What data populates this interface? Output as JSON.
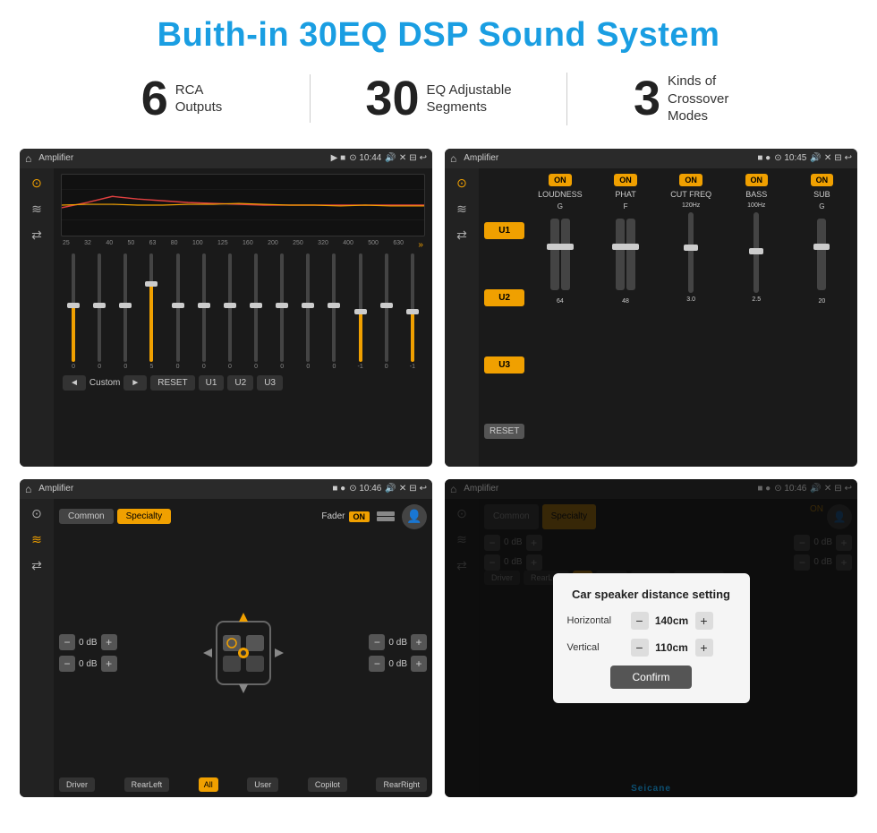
{
  "page": {
    "title": "Buith-in 30EQ DSP Sound System",
    "stats": [
      {
        "number": "6",
        "label": "RCA\nOutputs"
      },
      {
        "number": "30",
        "label": "EQ Adjustable\nSegments"
      },
      {
        "number": "3",
        "label": "Kinds of\nCrossover Modes"
      }
    ],
    "screens": [
      {
        "id": "eq-screen",
        "statusBar": {
          "title": "Amplifier",
          "time": "10:44"
        },
        "type": "eq"
      },
      {
        "id": "amp-screen",
        "statusBar": {
          "title": "Amplifier",
          "time": "10:45"
        },
        "type": "amp"
      },
      {
        "id": "fader-screen",
        "statusBar": {
          "title": "Amplifier",
          "time": "10:46"
        },
        "type": "fader"
      },
      {
        "id": "dialog-screen",
        "statusBar": {
          "title": "Amplifier",
          "time": "10:46"
        },
        "type": "dialog"
      }
    ],
    "eq": {
      "freqLabels": [
        "25",
        "32",
        "40",
        "50",
        "63",
        "80",
        "100",
        "125",
        "160",
        "200",
        "250",
        "320",
        "400",
        "500",
        "630"
      ],
      "sliderValues": [
        "0",
        "0",
        "0",
        "5",
        "0",
        "0",
        "0",
        "0",
        "0",
        "0",
        "0",
        "-1",
        "0",
        "-1"
      ],
      "bottomBtns": [
        "◄",
        "Custom",
        "►",
        "RESET",
        "U1",
        "U2",
        "U3"
      ]
    },
    "amp": {
      "channels": [
        {
          "label": "LOUDNESS",
          "on": true
        },
        {
          "label": "PHAT",
          "on": true
        },
        {
          "label": "CUT FREQ",
          "on": true
        },
        {
          "label": "BASS",
          "on": true
        },
        {
          "label": "SUB",
          "on": true
        }
      ],
      "uButtons": [
        "U1",
        "U2",
        "U3"
      ],
      "resetLabel": "RESET"
    },
    "fader": {
      "tabs": [
        "Common",
        "Specialty"
      ],
      "faderLabel": "Fader",
      "onLabel": "ON",
      "dbValues": [
        "0 dB",
        "0 dB",
        "0 dB",
        "0 dB"
      ],
      "zoneButtons": [
        "Driver",
        "RearLeft",
        "All",
        "User",
        "Copilot",
        "RearRight"
      ]
    },
    "dialog": {
      "title": "Car speaker distance setting",
      "horizontal": {
        "label": "Horizontal",
        "value": "140cm"
      },
      "vertical": {
        "label": "Vertical",
        "value": "110cm"
      },
      "confirmLabel": "Confirm",
      "dbValues": [
        "0 dB",
        "0 dB"
      ]
    },
    "watermark": "Seicane"
  }
}
